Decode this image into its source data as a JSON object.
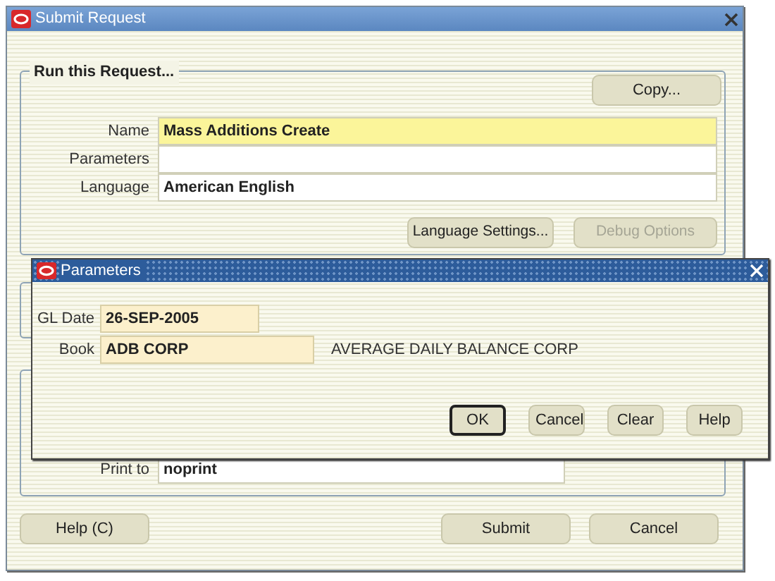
{
  "main_window": {
    "title": "Submit Request",
    "request_group": {
      "legend": "Run this Request...",
      "copy_button": "Copy...",
      "fields": [
        {
          "label": "Name",
          "value": "Mass Additions Create",
          "required": true
        },
        {
          "label": "Parameters",
          "required": false
        },
        {
          "label": "Language",
          "value": "American English",
          "required": false
        }
      ],
      "buttons": [
        {
          "label": "Language Settings...",
          "disabled": false
        },
        {
          "label": "Debug Options",
          "disabled": true
        }
      ]
    },
    "print_group": {
      "fields": [
        {
          "label": "Print to",
          "value": "noprint"
        }
      ]
    },
    "footer_left_buttons": [
      "Help (C)"
    ],
    "footer_right_buttons": [
      "Submit",
      "Cancel"
    ]
  },
  "parameters_dialog": {
    "title": "Parameters",
    "fields": [
      {
        "label": "GL Date",
        "value": "26-SEP-2005"
      },
      {
        "label": "Book",
        "value": "ADB CORP",
        "description": "AVERAGE DAILY BALANCE CORP"
      }
    ],
    "buttons": [
      {
        "label": "OK",
        "default": true
      },
      {
        "label": "Cancel",
        "default": false
      },
      {
        "label": "Clear",
        "default": false
      },
      {
        "label": "Help",
        "default": false
      }
    ]
  }
}
